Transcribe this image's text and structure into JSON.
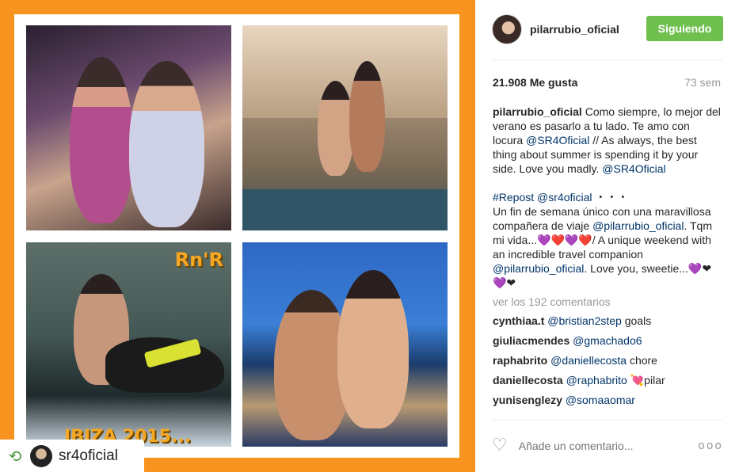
{
  "post": {
    "repost_user": "sr4oficial",
    "overlay_rnr": "Rn'R",
    "overlay_ibiza": "IBIZA 2015..."
  },
  "header": {
    "username": "pilarrubio_oficial",
    "follow_label": "Siguiendo"
  },
  "stats": {
    "likes": "21.908 Me gusta",
    "time": "73 sem"
  },
  "caption": {
    "user": "pilarrubio_oficial",
    "text1": "Como siempre, lo mejor del verano es pasarlo a tu lado. Te amo con locura ",
    "mention1": "@SR4Oficial",
    "text2": " // As always, the best thing about summer is spending it by your side. Love you madly. ",
    "mention2": "@SR4Oficial",
    "repost_tag": "#Repost",
    "repost_mention": "@sr4oficial",
    "repost_dots": " ・・・",
    "text3": "Un fin de semana único con una maravillosa compañera de viaje ",
    "mention3": "@pilarrubio_oficial",
    "text4": ". Tqm mi vida...💜❤️💜❤️/ A unique weekend with an incredible travel companion ",
    "mention4": "@pilarrubio_oficial",
    "text5": ". Love you, sweetie...💜❤💜❤"
  },
  "view_all": "ver los 192 comentarios",
  "comments": [
    {
      "user": "cynthiaa.t",
      "mention": "@bristian2step",
      "text": " goals"
    },
    {
      "user": "giuliacmendes",
      "mention": "@gmachado6",
      "text": ""
    },
    {
      "user": "raphabrito",
      "mention": "@daniellecosta",
      "text": " chore"
    },
    {
      "user": "daniellecosta",
      "mention": "@raphabrito",
      "text": " 💘pilar"
    },
    {
      "user": "yunisenglezy",
      "mention": "@somaaomar",
      "text": ""
    }
  ],
  "footer": {
    "placeholder": "Añade un comentario...",
    "more": "ooo"
  },
  "colors": {
    "accent_orange": "#f7931e",
    "follow_green": "#70c050",
    "mention_blue": "#003569"
  }
}
